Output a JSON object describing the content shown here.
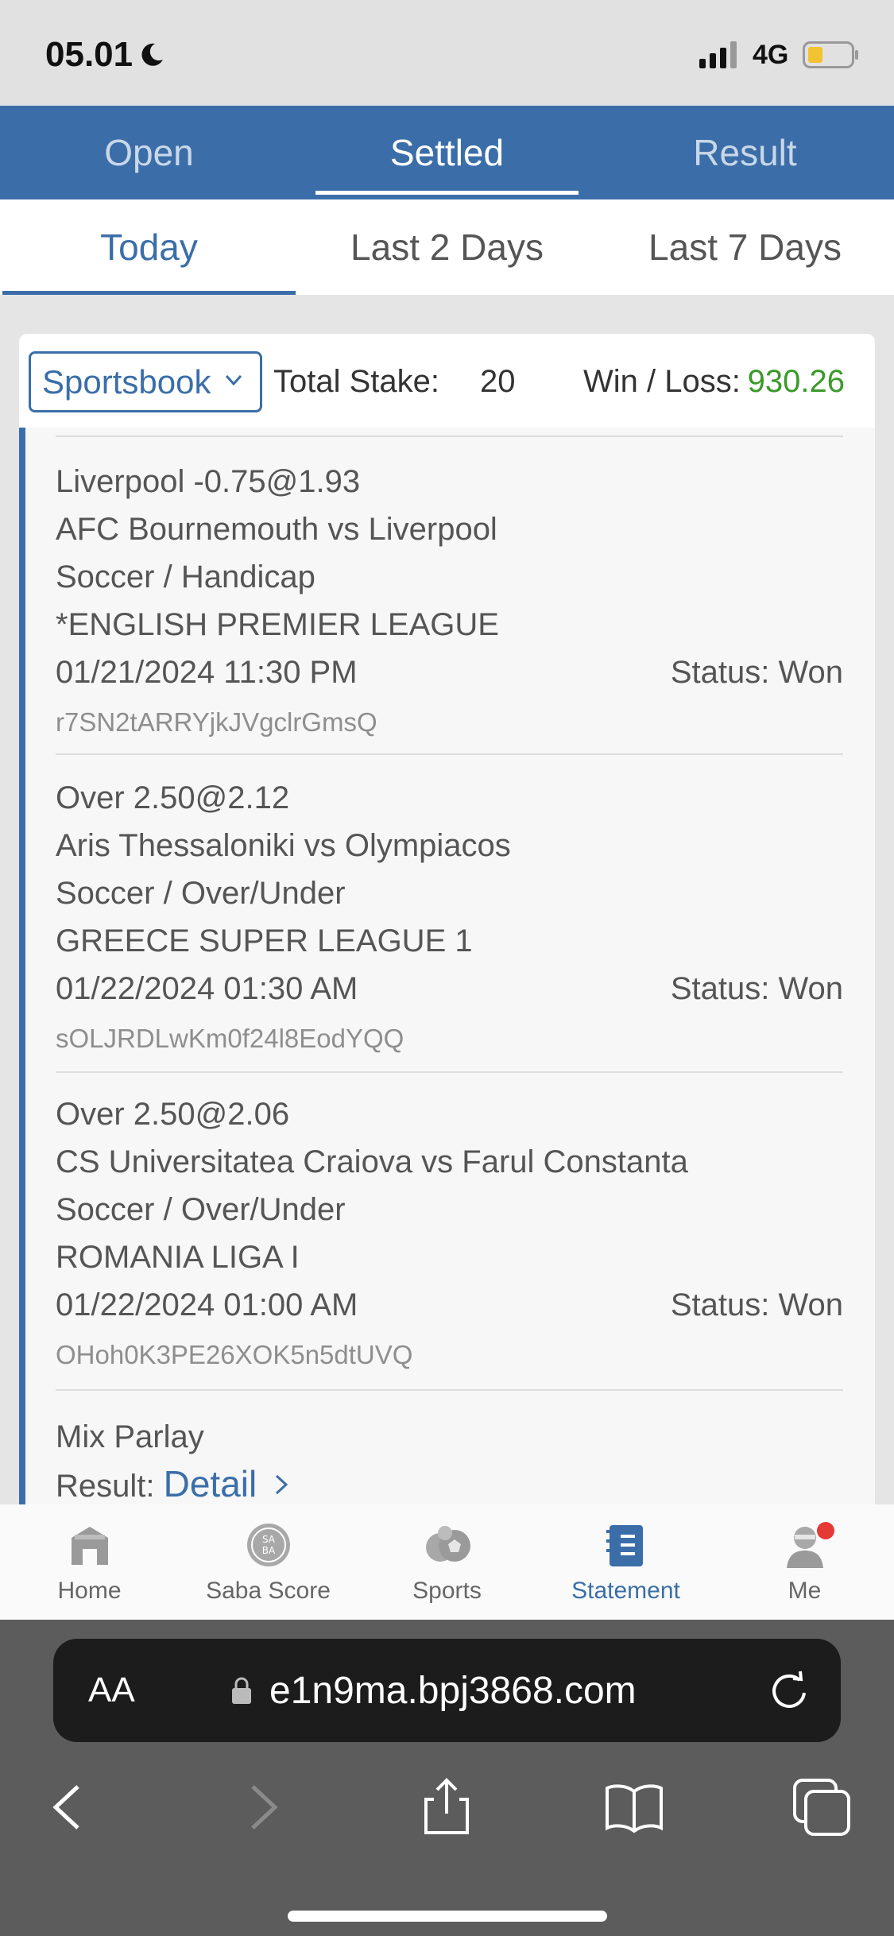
{
  "status_bar": {
    "time": "05.01",
    "network": "4G"
  },
  "top_tabs": [
    {
      "label": "Open",
      "active": false
    },
    {
      "label": "Settled",
      "active": true
    },
    {
      "label": "Result",
      "active": false
    }
  ],
  "sub_tabs": [
    {
      "label": "Today",
      "active": true
    },
    {
      "label": "Last 2 Days",
      "active": false
    },
    {
      "label": "Last 7 Days",
      "active": false
    }
  ],
  "filter": {
    "product": "Sportsbook",
    "total_stake_label": "Total Stake:",
    "total_stake": "20",
    "win_loss_label": "Win / Loss:",
    "win_loss": "930.26"
  },
  "bets": [
    {
      "selection": "Liverpool -0.75@1.93",
      "match": "AFC Bournemouth vs Liverpool",
      "market": "Soccer / Handicap",
      "league": "*ENGLISH PREMIER LEAGUE",
      "datetime": "01/21/2024 11:30 PM",
      "status_label": "Status:",
      "status": "Won",
      "ref": "r7SN2tARRYjkJVgclrGmsQ"
    },
    {
      "selection": "Over 2.50@2.12",
      "match": "Aris Thessaloniki vs Olympiacos",
      "market": "Soccer / Over/Under",
      "league": "GREECE SUPER LEAGUE 1",
      "datetime": "01/22/2024 01:30 AM",
      "status_label": "Status:",
      "status": "Won",
      "ref": "sOLJRDLwKm0f24l8EodYQQ"
    },
    {
      "selection": "Over 2.50@2.06",
      "match": "CS Universitatea Craiova vs Farul Constanta",
      "market": "Soccer / Over/Under",
      "league": "ROMANIA LIGA I",
      "datetime": "01/22/2024 01:00 AM",
      "status_label": "Status:",
      "status": "Won",
      "ref": "OHoh0K3PE26XOK5n5dtUVQ"
    }
  ],
  "parlay": {
    "title": "Mix Parlay",
    "result_label": "Result:",
    "detail_link": "Detail"
  },
  "bottom_nav": [
    {
      "label": "Home",
      "icon": "home-icon",
      "active": false
    },
    {
      "label": "Saba Score",
      "icon": "saba-score-icon",
      "active": false
    },
    {
      "label": "Sports",
      "icon": "sports-icon",
      "active": false
    },
    {
      "label": "Statement",
      "icon": "statement-icon",
      "active": true
    },
    {
      "label": "Me",
      "icon": "profile-icon",
      "active": false
    }
  ],
  "browser": {
    "aa_label": "AA",
    "url": "e1n9ma.bpj3868.com"
  },
  "colors": {
    "brand": "#3b6ea8",
    "win_loss": "#3a9a2a",
    "badge": "#e53935"
  }
}
